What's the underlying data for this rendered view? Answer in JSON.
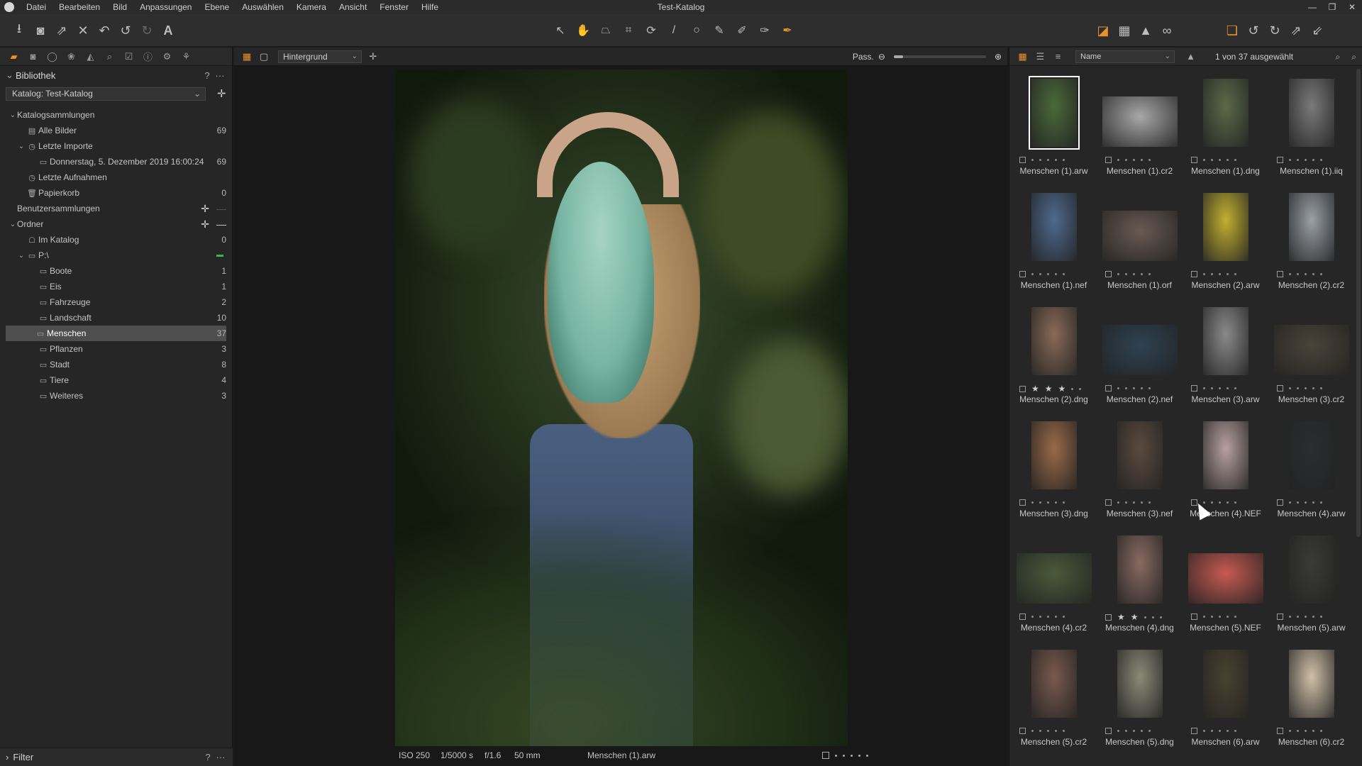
{
  "app": {
    "window_title": "Test-Katalog",
    "menu": [
      "Datei",
      "Bearbeiten",
      "Bild",
      "Anpassungen",
      "Ebene",
      "Auswählen",
      "Kamera",
      "Ansicht",
      "Fenster",
      "Hilfe"
    ]
  },
  "toolbar": {
    "left_icons": [
      "import-icon",
      "camera-icon",
      "export-icon",
      "delete-icon",
      "undo-history-icon",
      "undo-icon",
      "redo-icon",
      "text-icon"
    ],
    "center_icons": [
      "select-cursor-icon",
      "pan-hand-icon",
      "perspective-icon",
      "crop-icon",
      "rotate-icon",
      "straighten-icon",
      "circle-mask-icon",
      "brush-icon",
      "eraser-icon",
      "gradient-icon",
      "heal-icon"
    ],
    "right_icons": [
      "exposure-warning-icon",
      "grid-icon",
      "warning-icon",
      "glasses-icon",
      "layers-icon",
      "rotate-left-icon",
      "rotate-right-icon",
      "expand-icon",
      "collapse-icon"
    ],
    "accent_color": "#e8922a"
  },
  "library": {
    "title": "Bibliothek",
    "help": "?",
    "more": "···",
    "catalog_select": "Katalog: Test-Katalog",
    "tree": [
      {
        "label": "Katalogsammlungen",
        "level": 0,
        "expand": "v",
        "icon": "",
        "count": ""
      },
      {
        "label": "Alle Bilder",
        "level": 1,
        "expand": "",
        "icon": "images-icon",
        "count": "69"
      },
      {
        "label": "Letzte Importe",
        "level": 1,
        "expand": "v",
        "icon": "clock-icon",
        "count": ""
      },
      {
        "label": "Donnerstag, 5. Dezember 2019 16:00:24",
        "level": 2,
        "expand": "",
        "icon": "image-icon",
        "count": "69"
      },
      {
        "label": "Letzte Aufnahmen",
        "level": 1,
        "expand": "",
        "icon": "clock-icon",
        "count": ""
      },
      {
        "label": "Papierkorb",
        "level": 1,
        "expand": "",
        "icon": "trash-icon",
        "count": "0"
      },
      {
        "label": "Benutzersammlungen",
        "level": 0,
        "expand": "",
        "icon": "",
        "count": ""
      },
      {
        "label": "Ordner",
        "level": 0,
        "expand": "v",
        "icon": "",
        "count": ""
      },
      {
        "label": "Im Katalog",
        "level": 1,
        "expand": "",
        "icon": "catalog-icon",
        "count": "0"
      },
      {
        "label": "P:\\",
        "level": 1,
        "expand": "v",
        "icon": "drive-icon",
        "count": ""
      },
      {
        "label": "Boote",
        "level": 2,
        "expand": "",
        "icon": "folder-icon",
        "count": "1"
      },
      {
        "label": "Eis",
        "level": 2,
        "expand": "",
        "icon": "folder-icon",
        "count": "1"
      },
      {
        "label": "Fahrzeuge",
        "level": 2,
        "expand": "",
        "icon": "folder-icon",
        "count": "2"
      },
      {
        "label": "Landschaft",
        "level": 2,
        "expand": "",
        "icon": "folder-icon",
        "count": "10"
      },
      {
        "label": "Menschen",
        "level": 2,
        "expand": "",
        "icon": "folder-icon",
        "count": "37",
        "selected": true
      },
      {
        "label": "Pflanzen",
        "level": 2,
        "expand": "",
        "icon": "folder-icon",
        "count": "3"
      },
      {
        "label": "Stadt",
        "level": 2,
        "expand": "",
        "icon": "folder-icon",
        "count": "8"
      },
      {
        "label": "Tiere",
        "level": 2,
        "expand": "",
        "icon": "folder-icon",
        "count": "4"
      },
      {
        "label": "Weiteres",
        "level": 2,
        "expand": "",
        "icon": "folder-icon",
        "count": "3"
      }
    ],
    "filter_title": "Filter"
  },
  "viewer": {
    "layer_select": "Hintergrund",
    "zoom_label": "Pass.",
    "zoom_fraction": 0.1,
    "status": {
      "iso": "ISO 250",
      "shutter": "1/5000 s",
      "aperture": "f/1.6",
      "focal": "50 mm",
      "filename": "Menschen (1).arw"
    }
  },
  "browser": {
    "sort_select": "Name",
    "selection_count": "1 von 37 ausgewählt",
    "thumbnails": [
      {
        "name": "Menschen (1).arw",
        "stars": 0,
        "selected": true,
        "orientation": "portrait",
        "color": "#4a6a3a"
      },
      {
        "name": "Menschen (1).cr2",
        "stars": 0,
        "orientation": "landscape",
        "color": "#a8a8a8"
      },
      {
        "name": "Menschen (1).dng",
        "stars": 0,
        "orientation": "portrait",
        "color": "#5a6a48"
      },
      {
        "name": "Menschen (1).iiq",
        "stars": 0,
        "orientation": "portrait",
        "color": "#7a7a7a"
      },
      {
        "name": "Menschen (1).nef",
        "stars": 0,
        "orientation": "portrait",
        "color": "#4e6a8e"
      },
      {
        "name": "Menschen (1).orf",
        "stars": 0,
        "orientation": "landscape",
        "color": "#6a5a52"
      },
      {
        "name": "Menschen (2).arw",
        "stars": 0,
        "orientation": "portrait",
        "color": "#c2b030"
      },
      {
        "name": "Menschen (2).cr2",
        "stars": 0,
        "orientation": "portrait",
        "color": "#9aa0a6"
      },
      {
        "name": "Menschen (2).dng",
        "stars": 3,
        "orientation": "portrait",
        "color": "#8a6a58"
      },
      {
        "name": "Menschen (2).nef",
        "stars": 0,
        "orientation": "landscape",
        "color": "#2e4252"
      },
      {
        "name": "Menschen (3).arw",
        "stars": 0,
        "orientation": "portrait",
        "color": "#8a8a8a"
      },
      {
        "name": "Menschen (3).cr2",
        "stars": 0,
        "orientation": "landscape",
        "color": "#4a4438"
      },
      {
        "name": "Menschen (3).dng",
        "stars": 0,
        "orientation": "portrait",
        "color": "#9a6a48"
      },
      {
        "name": "Menschen (3).nef",
        "stars": 0,
        "orientation": "portrait",
        "color": "#5a4a3e"
      },
      {
        "name": "Menschen (4).NEF",
        "stars": 0,
        "orientation": "portrait",
        "color": "#b8a0a0"
      },
      {
        "name": "Menschen (4).arw",
        "stars": 0,
        "orientation": "portrait",
        "color": "#2a2e30"
      },
      {
        "name": "Menschen (4).cr2",
        "stars": 0,
        "orientation": "landscape",
        "color": "#4a5a3a"
      },
      {
        "name": "Menschen (4).dng",
        "stars": 2,
        "orientation": "portrait",
        "color": "#8a6a62"
      },
      {
        "name": "Menschen (5).NEF",
        "stars": 0,
        "orientation": "landscape",
        "color": "#c85a52"
      },
      {
        "name": "Menschen (5).arw",
        "stars": 0,
        "orientation": "portrait",
        "color": "#3a3a36"
      },
      {
        "name": "Menschen (5).cr2",
        "stars": 0,
        "orientation": "portrait",
        "color": "#7a5a4e"
      },
      {
        "name": "Menschen (5).dng",
        "stars": 0,
        "orientation": "portrait",
        "color": "#8a8a78"
      },
      {
        "name": "Menschen (6).arw",
        "stars": 0,
        "orientation": "portrait",
        "color": "#4a4230"
      },
      {
        "name": "Menschen (6).cr2",
        "stars": 0,
        "orientation": "portrait",
        "color": "#d0c0a8"
      }
    ]
  }
}
